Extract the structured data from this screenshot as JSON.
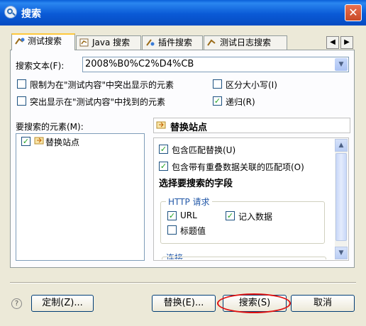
{
  "window": {
    "title": "搜索",
    "close_glyph": "✕"
  },
  "tabs": [
    {
      "label": "测试搜索",
      "active": true
    },
    {
      "label": "Java 搜索"
    },
    {
      "label": "插件搜索"
    },
    {
      "label": "测试日志搜索"
    }
  ],
  "search": {
    "label": "搜索文本(F):",
    "value": "2008%B0%C2%D4%CB"
  },
  "options": [
    {
      "label": "限制为在\"测试内容\"中突出显示的元素",
      "checked": false
    },
    {
      "label": "区分大小写(I)",
      "checked": false
    },
    {
      "label": "突出显示在\"测试内容\"中找到的元素",
      "checked": false
    },
    {
      "label": "递归(R)",
      "checked": true
    }
  ],
  "elements": {
    "label": "要搜索的元素(M):",
    "items": [
      {
        "label": "替换站点",
        "checked": true
      }
    ]
  },
  "detail": {
    "header": "替换站点",
    "include_replacement": "包含匹配替换(U)",
    "include_overlap": "包含带有重叠数据关联的匹配项(O)",
    "fields_title": "选择要搜索的字段",
    "http_group": "HTTP 请求",
    "url": "URL",
    "record": "记入数据",
    "header_value": "标题值",
    "connect": "连接"
  },
  "buttons": {
    "customize": "定制(Z)...",
    "replace": "替换(E)...",
    "search": "搜索(S)",
    "cancel": "取消"
  },
  "colors": {
    "accent": "#ffc83c",
    "title_bar": "#0a5ad6",
    "highlight_oval": "#e01010"
  }
}
